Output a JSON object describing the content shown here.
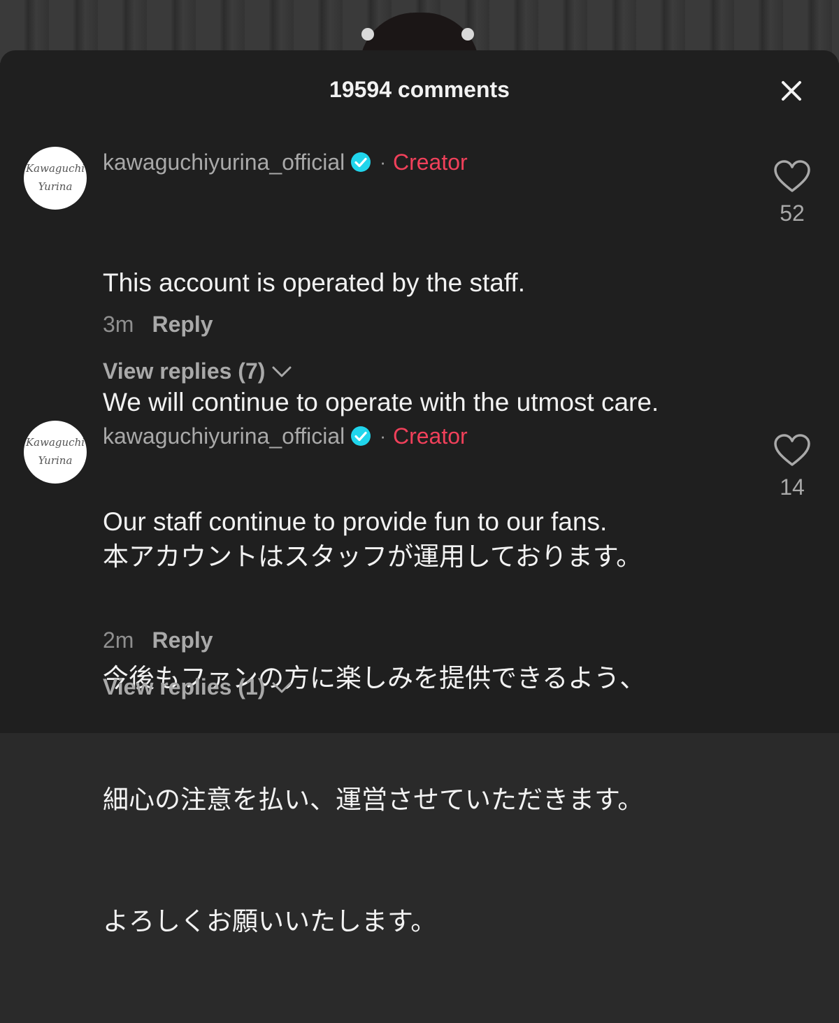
{
  "header": {
    "title": "19594 comments"
  },
  "comments": [
    {
      "username": "kawaguchiyurina_official",
      "badge": "Creator",
      "avatar_text": [
        "Kawaguchi",
        "Yurina"
      ],
      "lines": [
        "This account is operated by the staff.",
        "We will continue to operate with the utmost care.",
        "Our staff continue to provide fun to our fans."
      ],
      "time": "3m",
      "reply_label": "Reply",
      "view_replies": "View replies (7)",
      "likes": "52"
    },
    {
      "username": "kawaguchiyurina_official",
      "badge": "Creator",
      "avatar_text": [
        "Kawaguchi",
        "Yurina"
      ],
      "lines": [
        "本アカウントはスタッフが運用しております。",
        "今後もファンの方に楽しみを提供できるよう、",
        "細心の注意を払い、運営させていただきます。",
        "よろしくお願いいたします。"
      ],
      "time": "2m",
      "reply_label": "Reply",
      "view_replies": "View replies (1)",
      "likes": "14"
    }
  ],
  "colors": {
    "creator": "#f0405a",
    "verified": "#20d5ec",
    "sheet": "#1f1f1f"
  },
  "icons": [
    "close-icon",
    "verified-icon",
    "heart-icon",
    "chevron-down-icon"
  ]
}
